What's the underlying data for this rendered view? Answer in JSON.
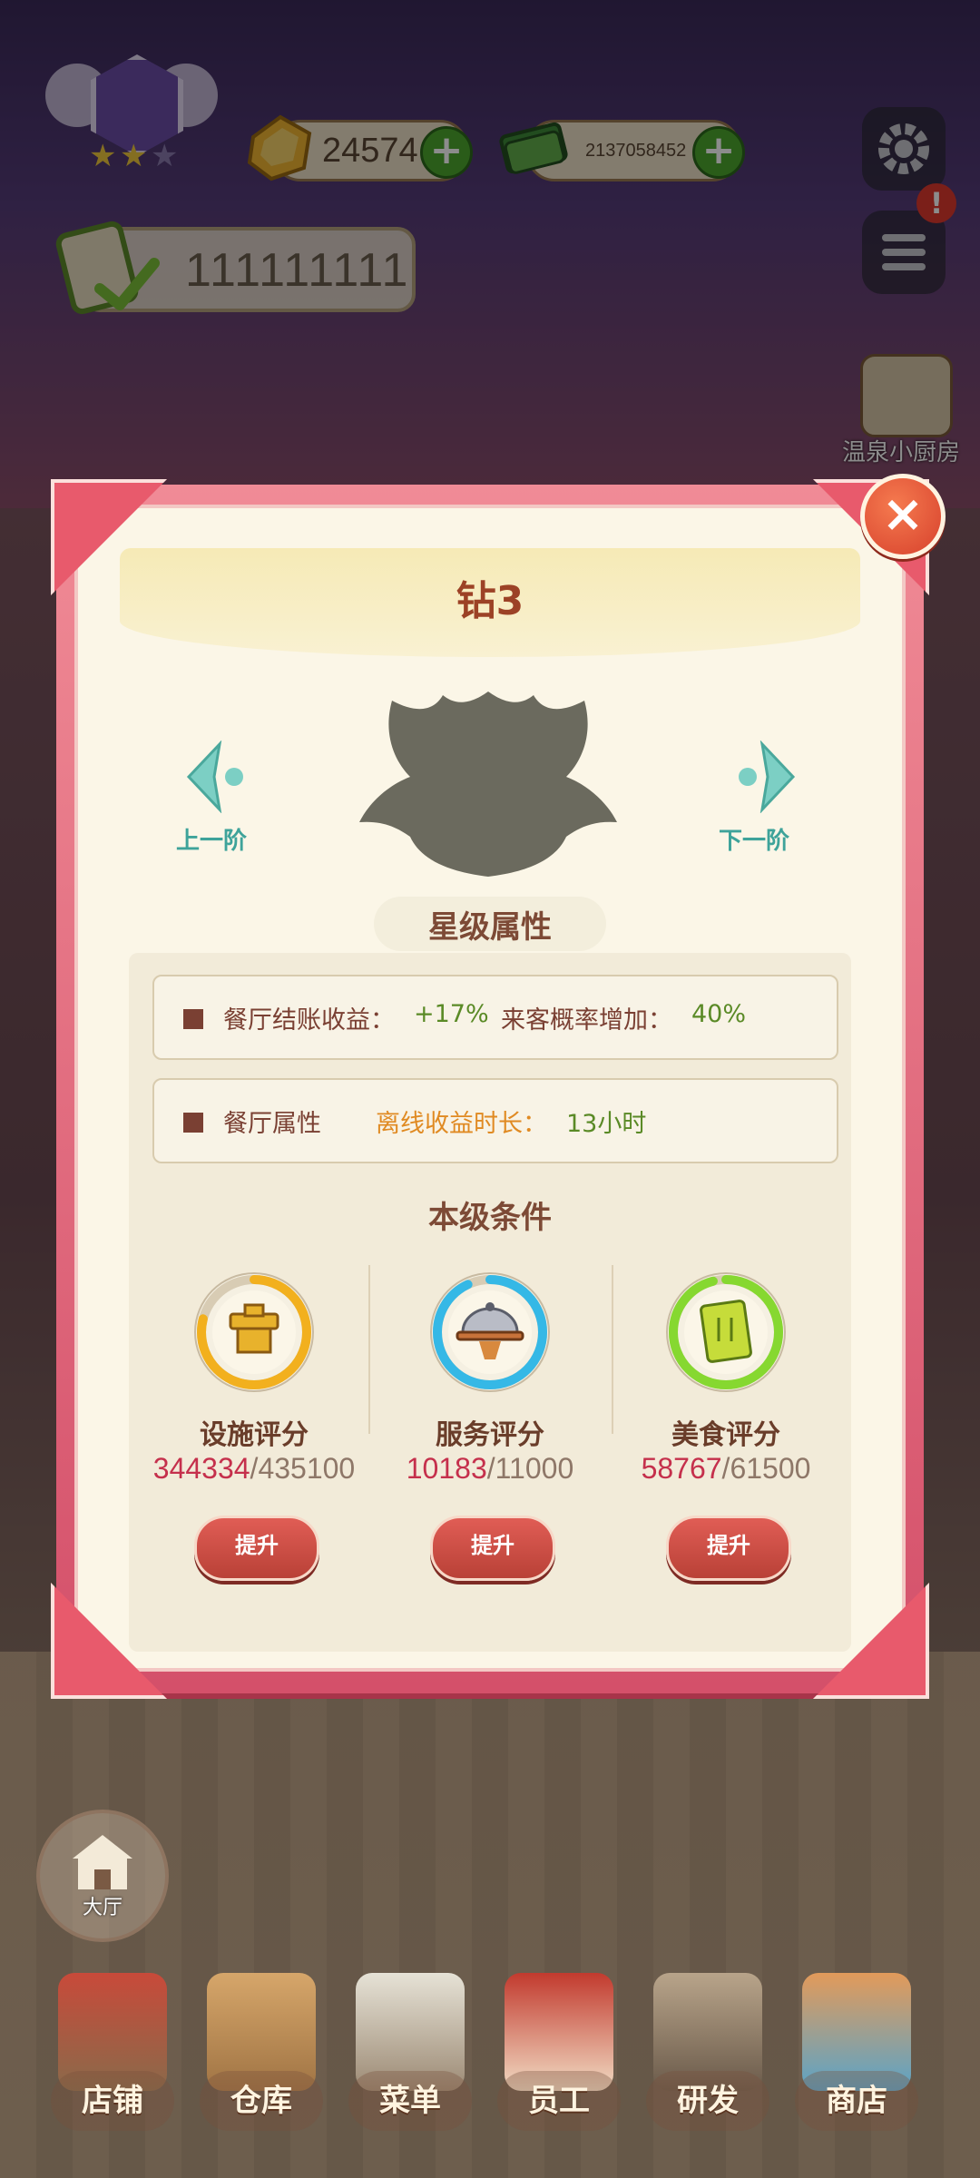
{
  "hud": {
    "gold_amount": "24574",
    "cash_amount": "2137058452",
    "restaurant_score": "111111111",
    "kitchen_label": "温泉小厨房"
  },
  "modal": {
    "title": "钻3",
    "prev_label": "上一阶",
    "next_label": "下一阶",
    "star_attr_header": "星级属性",
    "attr_row1": {
      "label1": "餐厅结账收益：",
      "value1": "+17%",
      "label2": "来客概率增加：",
      "value2": "40%"
    },
    "attr_row2": {
      "label": "餐厅属性",
      "sub_label": "离线收益时长：",
      "value": "13小时"
    },
    "conditions_header": "本级条件",
    "conditions": [
      {
        "name": "设施评分",
        "current": "344334",
        "max": "/435100",
        "button": "提升",
        "progress": 0.79,
        "ring_color": "#f2b01e"
      },
      {
        "name": "服务评分",
        "current": "10183",
        "max": "/11000",
        "button": "提升",
        "progress": 0.93,
        "ring_color": "#35b8e6"
      },
      {
        "name": "美食评分",
        "current": "58767",
        "max": "/61500",
        "button": "提升",
        "progress": 0.96,
        "ring_color": "#86d830"
      }
    ],
    "close_symbol": "×"
  },
  "hall": {
    "label": "大厅"
  },
  "nav": [
    {
      "label": "店铺",
      "icon": "shop-icon"
    },
    {
      "label": "仓库",
      "icon": "warehouse-icon"
    },
    {
      "label": "菜单",
      "icon": "menu-icon"
    },
    {
      "label": "员工",
      "icon": "staff-icon"
    },
    {
      "label": "研发",
      "icon": "research-icon"
    },
    {
      "label": "商店",
      "icon": "store-icon"
    }
  ],
  "colors": {
    "accent_green": "#5a8a26",
    "accent_orange": "#e08a22",
    "label_brown": "#7a4033"
  }
}
